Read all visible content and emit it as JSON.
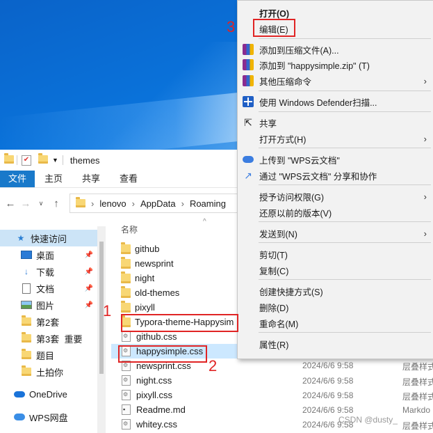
{
  "explorer": {
    "title": "themes",
    "ribbon_tabs": [
      "文件",
      "主页",
      "共享",
      "查看"
    ],
    "breadcrumb": [
      "lenovo",
      "AppData",
      "Roaming"
    ],
    "column_header": "名称",
    "sidebar": [
      {
        "label": "快速访问",
        "icon": "star-icon"
      },
      {
        "label": "桌面",
        "icon": "desktop-icon"
      },
      {
        "label": "下载",
        "icon": "download-icon"
      },
      {
        "label": "文档",
        "icon": "document-icon"
      },
      {
        "label": "图片",
        "icon": "picture-icon"
      },
      {
        "label": "第2套",
        "icon": "folder-icon"
      },
      {
        "label": "第3套  重要",
        "icon": "folder-icon"
      },
      {
        "label": "题目",
        "icon": "folder-icon"
      },
      {
        "label": "土拍你",
        "icon": "folder-icon"
      },
      {
        "label": "OneDrive",
        "icon": "onedrive-icon"
      },
      {
        "label": "WPS网盘",
        "icon": "wps-cloud-icon"
      }
    ],
    "files": [
      {
        "name": "github",
        "kind": "folder",
        "date": "",
        "type": ""
      },
      {
        "name": "newsprint",
        "kind": "folder",
        "date": "",
        "type": ""
      },
      {
        "name": "night",
        "kind": "folder",
        "date": "",
        "type": ""
      },
      {
        "name": "old-themes",
        "kind": "folder",
        "date": "",
        "type": ""
      },
      {
        "name": "pixyll",
        "kind": "folder",
        "date": "",
        "type": ""
      },
      {
        "name": "Typora-theme-Happysim",
        "kind": "folder",
        "date": "",
        "type": ""
      },
      {
        "name": "github.css",
        "kind": "css",
        "date": "",
        "type": ""
      },
      {
        "name": "happysimple.css",
        "kind": "css",
        "date": "",
        "type": ""
      },
      {
        "name": "newsprint.css",
        "kind": "css",
        "date": "2024/6/6 9:58",
        "type": "层叠样式"
      },
      {
        "name": "night.css",
        "kind": "css",
        "date": "2024/6/6 9:58",
        "type": "层叠样式"
      },
      {
        "name": "pixyll.css",
        "kind": "css",
        "date": "2024/6/6 9:58",
        "type": "层叠样式"
      },
      {
        "name": "Readme.md",
        "kind": "md",
        "date": "2024/6/6 9:58",
        "type": "Markdo"
      },
      {
        "name": "whitey.css",
        "kind": "css",
        "date": "2024/6/6 9:58",
        "type": "层叠样式"
      }
    ]
  },
  "context_menu": {
    "items": [
      {
        "label": "打开(O)",
        "bold": true,
        "icon": "",
        "arrow": false
      },
      {
        "label": "编辑(E)",
        "bold": false,
        "icon": "",
        "arrow": false
      },
      {
        "label": "添加到压缩文件(A)...",
        "bold": false,
        "icon": "winrar-icon",
        "arrow": false
      },
      {
        "label": "添加到 \"happysimple.zip\" (T)",
        "bold": false,
        "icon": "winrar-icon",
        "arrow": false
      },
      {
        "label": "其他压缩命令",
        "bold": false,
        "icon": "winrar-icon",
        "arrow": true
      },
      {
        "label": "使用 Windows Defender扫描...",
        "bold": false,
        "icon": "defender-shield-icon",
        "arrow": false
      },
      {
        "label": "共享",
        "bold": false,
        "icon": "share-icon",
        "arrow": false
      },
      {
        "label": "打开方式(H)",
        "bold": false,
        "icon": "",
        "arrow": true
      },
      {
        "label": "上传到 \"WPS云文档\"",
        "bold": false,
        "icon": "wps-cloud-icon",
        "arrow": false
      },
      {
        "label": "通过 \"WPS云文档\" 分享和协作",
        "bold": false,
        "icon": "wps-share-icon",
        "arrow": false
      },
      {
        "label": "授予访问权限(G)",
        "bold": false,
        "icon": "",
        "arrow": true
      },
      {
        "label": "还原以前的版本(V)",
        "bold": false,
        "icon": "",
        "arrow": false
      },
      {
        "label": "发送到(N)",
        "bold": false,
        "icon": "",
        "arrow": true
      },
      {
        "label": "剪切(T)",
        "bold": false,
        "icon": "",
        "arrow": false
      },
      {
        "label": "复制(C)",
        "bold": false,
        "icon": "",
        "arrow": false
      },
      {
        "label": "创建快捷方式(S)",
        "bold": false,
        "icon": "",
        "arrow": false
      },
      {
        "label": "删除(D)",
        "bold": false,
        "icon": "",
        "arrow": false
      },
      {
        "label": "重命名(M)",
        "bold": false,
        "icon": "",
        "arrow": false
      },
      {
        "label": "属性(R)",
        "bold": false,
        "icon": "",
        "arrow": false
      }
    ]
  },
  "annotations": [
    "1",
    "2",
    "3"
  ],
  "watermark": "CSDN @dusty_",
  "colors": {
    "highlight": "#e02424",
    "accent": "#1979ca",
    "selection": "#cce8ff"
  }
}
